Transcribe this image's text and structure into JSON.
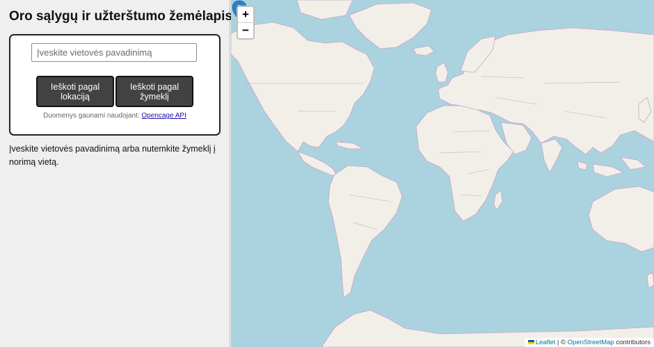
{
  "title": "Oro sąlygų ir užterštumo žemėlapis",
  "search": {
    "placeholder": "Įveskite vietovės pavadinimą",
    "value": ""
  },
  "buttons": {
    "by_location": "Ieškoti pagal lokaciją",
    "by_marker": "Ieškoti pagal žymeklį"
  },
  "credit": {
    "prefix": "Duomenys gaunami naudojant:",
    "link": "Opencage API"
  },
  "instructions": "Įveskite vietovės pavadinimą arba nutemkite žymeklį į norimą vietą.",
  "map": {
    "zoom_in": "+",
    "zoom_out": "−",
    "attribution": {
      "leaflet": "Leaflet",
      "separator": " | © ",
      "osm": "OpenStreetMap",
      "suffix": " contributors"
    },
    "colors": {
      "ocean": "#aad3df",
      "land": "#f2efe9",
      "border": "#c9a3c6",
      "marker": "#2a81cb"
    }
  }
}
